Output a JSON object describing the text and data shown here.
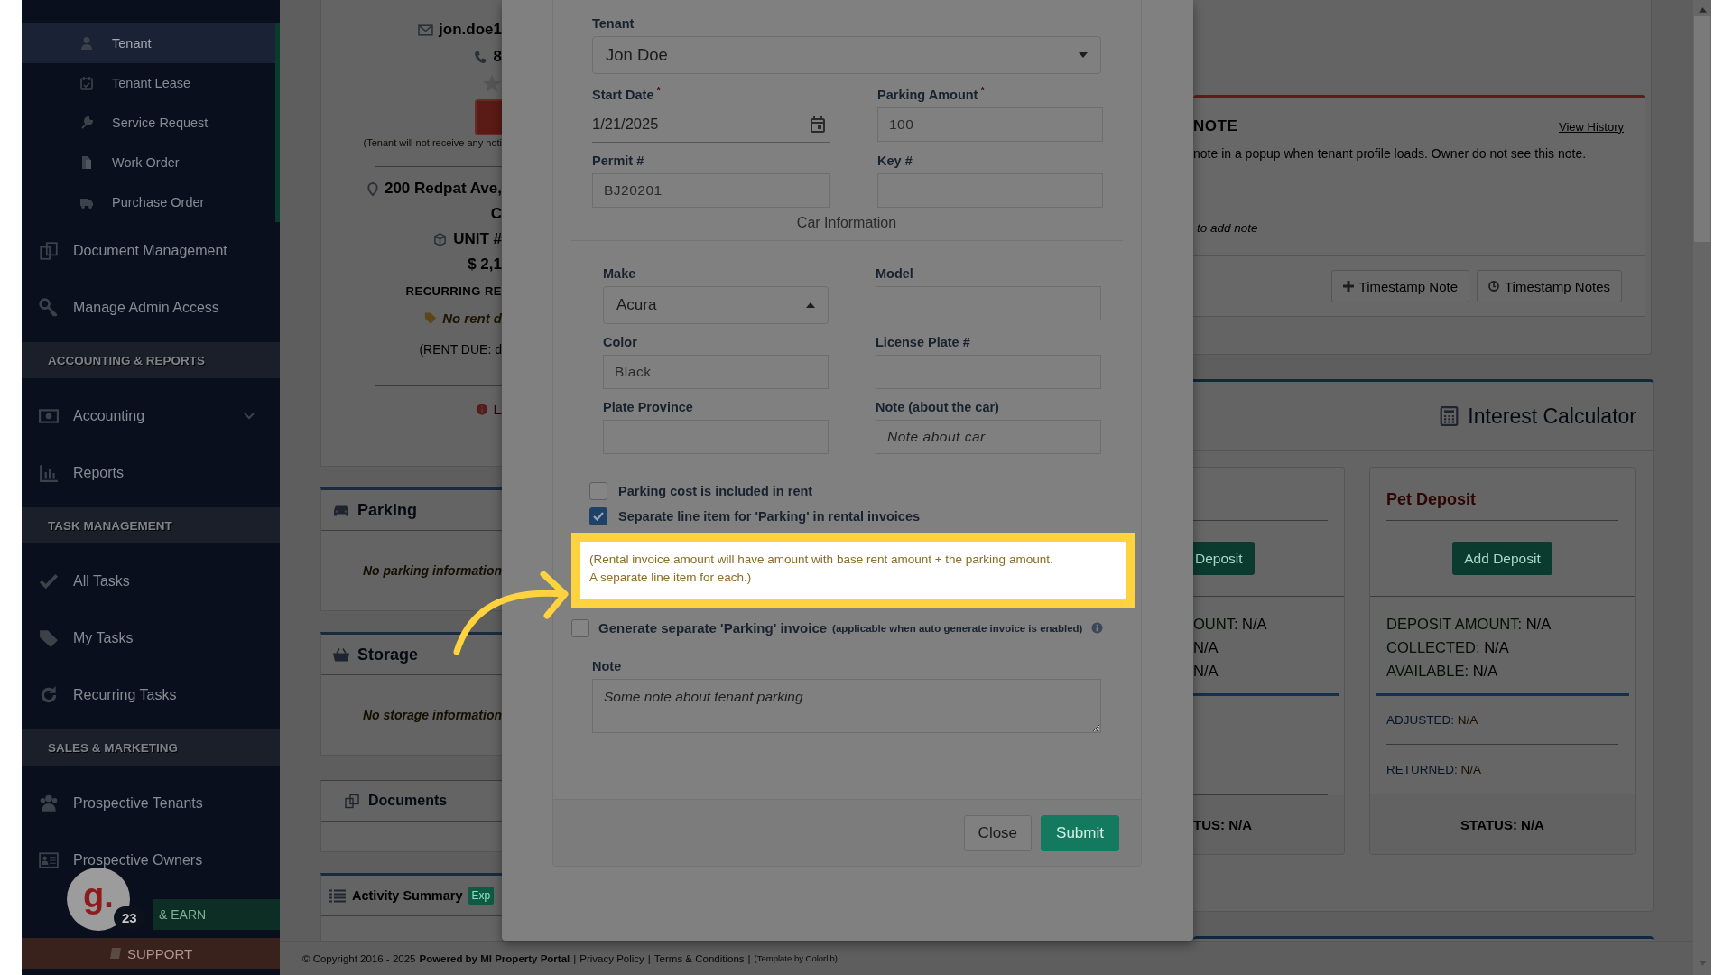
{
  "sidebar": {
    "subitems": [
      {
        "label": "Tenant",
        "selected": true
      },
      {
        "label": "Tenant Lease",
        "selected": false
      },
      {
        "label": "Service Request",
        "selected": false
      },
      {
        "label": "Work Order",
        "selected": false
      },
      {
        "label": "Purchase Order",
        "selected": false
      }
    ],
    "items": [
      {
        "label": "Document Management"
      },
      {
        "label": "Manage Admin Access"
      }
    ],
    "sections": [
      {
        "heading": "ACCOUNTING & REPORTS",
        "items": [
          {
            "label": "Accounting",
            "expanded": false
          },
          {
            "label": "Reports"
          }
        ]
      },
      {
        "heading": "TASK MANAGEMENT",
        "items": [
          {
            "label": "All Tasks"
          },
          {
            "label": "My Tasks"
          },
          {
            "label": "Recurring Tasks"
          }
        ]
      },
      {
        "heading": "SALES & MARKETING",
        "items": [
          {
            "label": "Prospective Tenants"
          },
          {
            "label": "Prospective Owners"
          }
        ]
      }
    ],
    "refer": "& EARN",
    "support": "SUPPORT"
  },
  "chat_widget": {
    "logo": "g.",
    "badge": "23"
  },
  "profile": {
    "email": "jon.doe1",
    "phone": "8",
    "notice": "(Tenant will not receive any noti",
    "address": [
      "200 Redpat Ave,",
      "C"
    ],
    "unit": "UNIT #",
    "rent": "$ 2,1",
    "recurring_label": "RECURRING RE",
    "rent_note": "No rent d",
    "rent_due": "(RENT DUE: d",
    "alert": "L"
  },
  "cards": [
    {
      "title": "Parking",
      "message": "No parking information"
    },
    {
      "title": "Storage",
      "message": "No storage information"
    },
    {
      "title": "Documents"
    },
    {
      "title": "Activity Summary",
      "badge": "Exp"
    }
  ],
  "modal": {
    "tenant": {
      "label": "Tenant",
      "value": "Jon Doe"
    },
    "start_date": {
      "label": "Start Date",
      "required_mark": "*",
      "value": "1/21/2025"
    },
    "parking_amount": {
      "label": "Parking Amount",
      "required_mark": "*",
      "value": "100"
    },
    "permit": {
      "label": "Permit #",
      "value": "BJ20201"
    },
    "key": {
      "label": "Key #"
    },
    "car_section": "Car Information",
    "car_fields": [
      {
        "label": "Make",
        "kind": "select",
        "value": "Acura",
        "expanded": true
      },
      {
        "label": "Model",
        "kind": "text"
      },
      {
        "label": "Color",
        "kind": "text",
        "value": "Black"
      },
      {
        "label": "License Plate #",
        "kind": "text"
      },
      {
        "label": "Plate Province",
        "kind": "text"
      },
      {
        "label": "Note (about the car)",
        "kind": "text",
        "placeholder": "Note about car"
      }
    ],
    "options": [
      {
        "label": "Parking cost is included in rent",
        "checked": false
      },
      {
        "label": "Separate line item for 'Parking' in rental invoices",
        "checked": true
      }
    ],
    "callout": "(Rental invoice amount will have amount with base rent amount + the parking amount. A separate line item for each.)",
    "generate": {
      "label": "Generate separate 'Parking' invoice",
      "hint": "(applicable when auto generate invoice is enabled)",
      "checked": false
    },
    "note": {
      "label": "Note",
      "placeholder": "Some note about tenant parking"
    },
    "buttons": [
      {
        "label": "Close",
        "kind": "default"
      },
      {
        "label": "Submit",
        "kind": "primary"
      }
    ]
  },
  "note_panel": {
    "title": "NOTE",
    "link": "View History",
    "description": "note in a popup when tenant profile loads. Owner do not see this note.",
    "prompt": "to add note",
    "buttons": [
      "Timestamp Note",
      "Timestamp Notes"
    ]
  },
  "calculator": {
    "title": "Interest Calculator",
    "deposits": [
      {
        "button": "Deposit",
        "lines": [
          {
            "label": "OUNT:",
            "value": "N/A"
          },
          {
            "value": "N/A"
          },
          {
            "value": "N/A"
          }
        ],
        "status": "TUS: N/A"
      },
      {
        "title": "Pet Deposit",
        "button": "Add Deposit",
        "lines": [
          {
            "label": "DEPOSIT AMOUNT:",
            "value": "N/A"
          },
          {
            "label": "COLLECTED:",
            "value": "N/A"
          },
          {
            "label": "AVAILABLE:",
            "value": "N/A"
          }
        ],
        "details": [
          {
            "label": "ADJUSTED:",
            "value": "N/A"
          },
          {
            "label": "RETURNED:",
            "value": "N/A"
          }
        ],
        "status": "STATUS: N/A"
      }
    ]
  },
  "footer": {
    "copyright": "© Copyright 2016 - 2025",
    "powered": "Powered by MI Property Portal",
    "links": [
      {
        "separator": "|",
        "label": "Privacy Policy"
      },
      {
        "separator": "|",
        "label": "Terms & Conditions"
      }
    ],
    "credit_separator": "|",
    "credit": "(Template by Colorlib)"
  }
}
